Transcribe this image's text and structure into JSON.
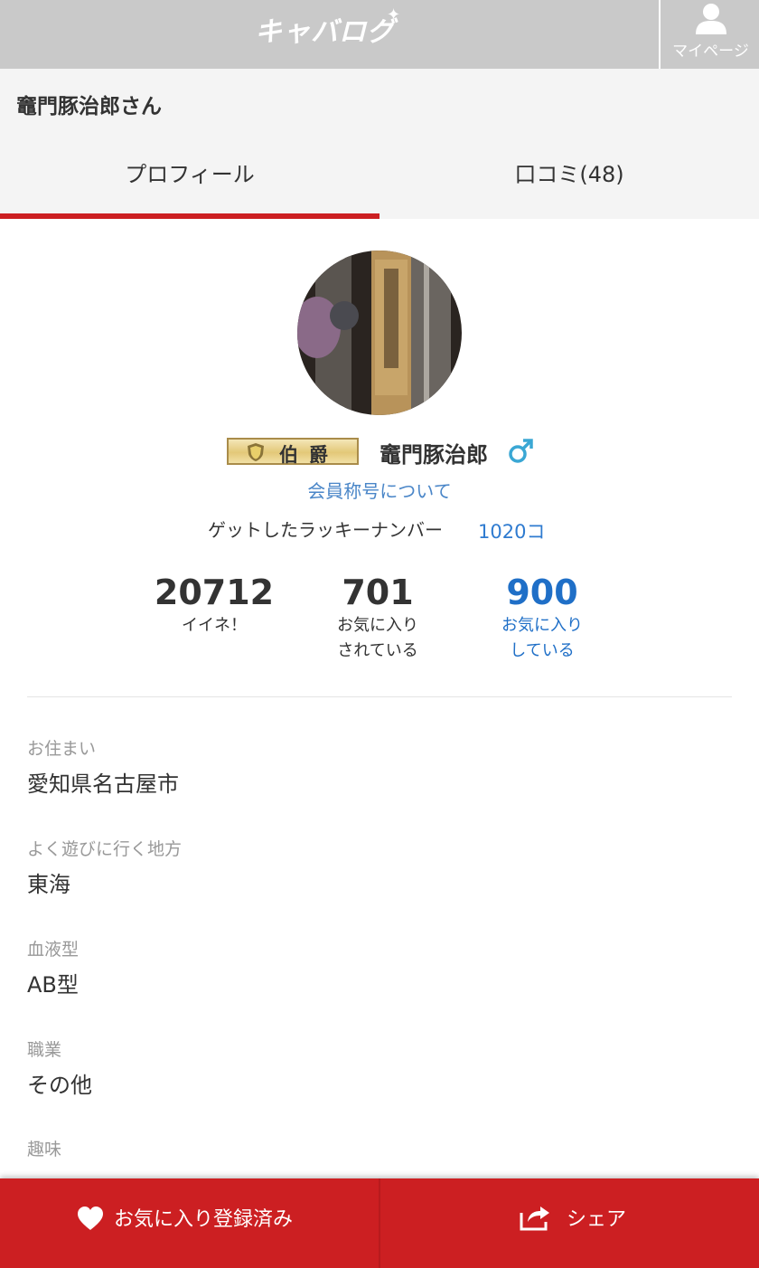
{
  "header": {
    "logo_text": "キャバログ",
    "mypage_label": "マイページ"
  },
  "greeting": "竈門豚治郎さん",
  "tabs": [
    {
      "label": "プロフィール",
      "active": true
    },
    {
      "label": "口コミ(48)",
      "active": false
    }
  ],
  "profile": {
    "avatar_icon": "avatar-photo",
    "title_badge": "伯爵",
    "name": "竈門豚治郎",
    "gender_icon": "male-icon",
    "rank_link": "会員称号について",
    "lucky_label": "ゲットしたラッキーナンバー",
    "lucky_value": "1020コ"
  },
  "stats": [
    {
      "number": "20712",
      "label_line1": "イイネ！",
      "label_line2": ""
    },
    {
      "number": "701",
      "label_line1": "お気に入り",
      "label_line2": "されている"
    },
    {
      "number": "900",
      "label_line1": "お気に入り",
      "label_line2": "している"
    }
  ],
  "fields": [
    {
      "label": "お住まい",
      "value": "愛知県名古屋市"
    },
    {
      "label": "よく遊びに行く地方",
      "value": "東海"
    },
    {
      "label": "血液型",
      "value": "AB型"
    },
    {
      "label": "職業",
      "value": "その他"
    },
    {
      "label": "趣味",
      "value": ""
    }
  ],
  "bottom_bar": {
    "favorite_label": "お気に入り登録済み",
    "share_label": "シェア"
  },
  "colors": {
    "accent_red": "#cc1f22",
    "link_blue": "#4a86c8",
    "stat_blue": "#1f6fc7",
    "header_gray": "#c9c9c9"
  }
}
